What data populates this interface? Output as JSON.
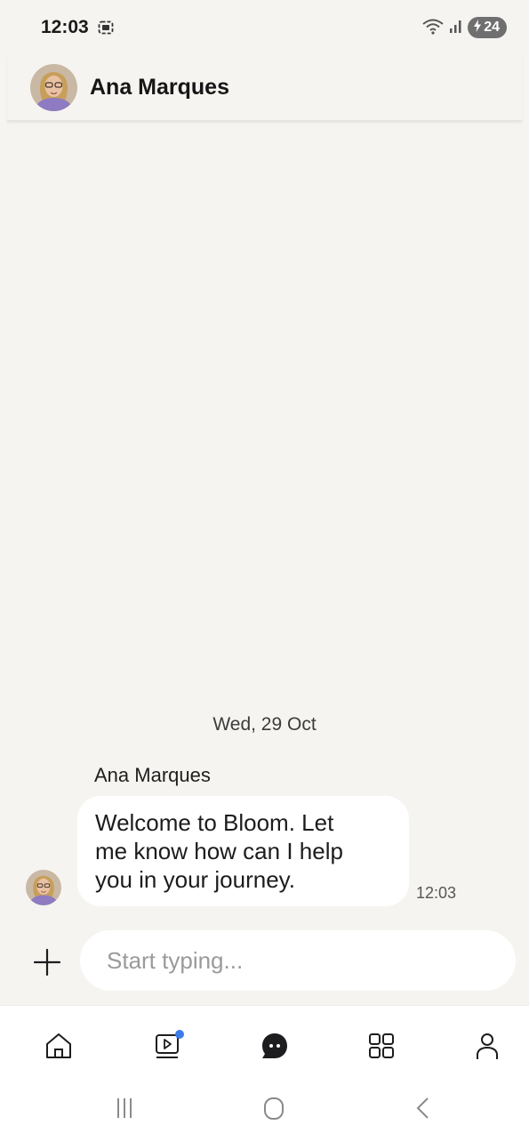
{
  "status_bar": {
    "time": "12:03",
    "battery": "24",
    "icons": [
      "screen-record-icon",
      "wifi-icon",
      "signal-icon",
      "charging-bolt-icon"
    ]
  },
  "header": {
    "contact_name": "Ana Marques",
    "avatar": "avatar-photo"
  },
  "conversation": {
    "date_separator": "Wed, 29 Oct",
    "messages": [
      {
        "sender": "Ana Marques",
        "lines": [
          "Welcome to Bloom. Let",
          "me know how can I help",
          "you in your journey."
        ],
        "time": "12:03"
      }
    ]
  },
  "composer": {
    "placeholder": "Start typing...",
    "value": "",
    "attach_icon": "plus-icon"
  },
  "tabbar": {
    "items": [
      {
        "name": "home",
        "icon": "home-icon"
      },
      {
        "name": "videos",
        "icon": "video-icon",
        "badge_color": "#3b7bea"
      },
      {
        "name": "chat",
        "icon": "chat-icon",
        "active": true
      },
      {
        "name": "apps",
        "icon": "grid-icon"
      },
      {
        "name": "profile",
        "icon": "person-icon"
      }
    ]
  },
  "colors": {
    "background": "#f5f4f1",
    "bubble": "#ffffff",
    "badge": "#3b7bea",
    "active_tab": "#1d1d1f"
  }
}
